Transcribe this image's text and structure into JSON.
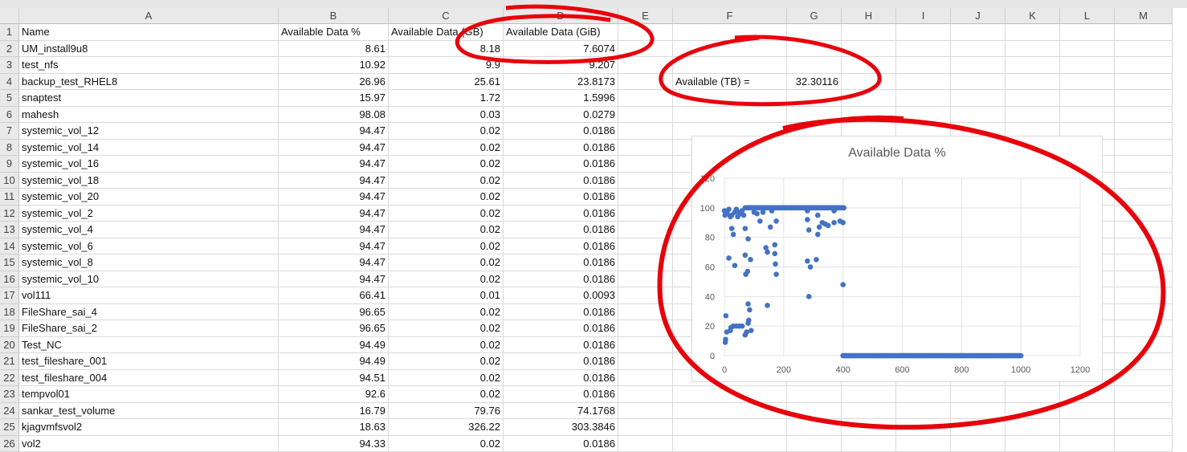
{
  "columns": [
    "A",
    "B",
    "C",
    "D",
    "E",
    "F",
    "G",
    "H",
    "I",
    "J",
    "K",
    "L",
    "M"
  ],
  "rows": [
    [
      "Name",
      "Available Data %",
      "Available Data (GB)",
      "Available Data (GiB)"
    ],
    [
      "UM_install9u8",
      "8.61",
      "8.18",
      "7.6074"
    ],
    [
      "test_nfs",
      "10.92",
      "9.9",
      "9.207"
    ],
    [
      "backup_test_RHEL8",
      "26.96",
      "25.61",
      "23.8173"
    ],
    [
      "snaptest",
      "15.97",
      "1.72",
      "1.5996"
    ],
    [
      "mahesh",
      "98.08",
      "0.03",
      "0.0279"
    ],
    [
      "systemic_vol_12",
      "94.47",
      "0.02",
      "0.0186"
    ],
    [
      "systemic_vol_14",
      "94.47",
      "0.02",
      "0.0186"
    ],
    [
      "systemic_vol_16",
      "94.47",
      "0.02",
      "0.0186"
    ],
    [
      "systemic_vol_18",
      "94.47",
      "0.02",
      "0.0186"
    ],
    [
      "systemic_vol_20",
      "94.47",
      "0.02",
      "0.0186"
    ],
    [
      "systemic_vol_2",
      "94.47",
      "0.02",
      "0.0186"
    ],
    [
      "systemic_vol_4",
      "94.47",
      "0.02",
      "0.0186"
    ],
    [
      "systemic_vol_6",
      "94.47",
      "0.02",
      "0.0186"
    ],
    [
      "systemic_vol_8",
      "94.47",
      "0.02",
      "0.0186"
    ],
    [
      "systemic_vol_10",
      "94.47",
      "0.02",
      "0.0186"
    ],
    [
      "vol111",
      "66.41",
      "0.01",
      "0.0093"
    ],
    [
      "FileShare_sai_4",
      "96.65",
      "0.02",
      "0.0186"
    ],
    [
      "FileShare_sai_2",
      "96.65",
      "0.02",
      "0.0186"
    ],
    [
      "Test_NC",
      "94.49",
      "0.02",
      "0.0186"
    ],
    [
      "test_fileshare_001",
      "94.49",
      "0.02",
      "0.0186"
    ],
    [
      "test_fileshare_004",
      "94.51",
      "0.02",
      "0.0186"
    ],
    [
      "tempvol01",
      "92.6",
      "0.02",
      "0.0186"
    ],
    [
      "sankar_test_volume",
      "16.79",
      "79.76",
      "74.1768"
    ],
    [
      "kjagvmfsvol2",
      "18.63",
      "326.22",
      "303.3846"
    ],
    [
      "vol2",
      "94.33",
      "0.02",
      "0.0186"
    ]
  ],
  "summary": {
    "label": "Available (TB) =",
    "value": "32.30116"
  },
  "chart_data": {
    "type": "scatter",
    "title": "Available Data %",
    "xlim": [
      0,
      1200
    ],
    "ylim": [
      0,
      120
    ],
    "xticks": [
      "0",
      "200",
      "400",
      "600",
      "800",
      "1000",
      "1200"
    ],
    "yticks": [
      "0",
      "20",
      "40",
      "60",
      "80",
      "100",
      "120"
    ],
    "grid": true,
    "color": "#4472c4",
    "points": [
      [
        0,
        98
      ],
      [
        2,
        95
      ],
      [
        5,
        27
      ],
      [
        3,
        9
      ],
      [
        4,
        11
      ],
      [
        8,
        16
      ],
      [
        20,
        17
      ],
      [
        22,
        19
      ],
      [
        30,
        20
      ],
      [
        40,
        20
      ],
      [
        50,
        20
      ],
      [
        60,
        20
      ],
      [
        10,
        96
      ],
      [
        20,
        94
      ],
      [
        25,
        86
      ],
      [
        30,
        82
      ],
      [
        35,
        61
      ],
      [
        15,
        66
      ],
      [
        70,
        14
      ],
      [
        75,
        16
      ],
      [
        80,
        22
      ],
      [
        82,
        24
      ],
      [
        80,
        35
      ],
      [
        85,
        31
      ],
      [
        90,
        17
      ],
      [
        72,
        55
      ],
      [
        78,
        57
      ],
      [
        70,
        68
      ],
      [
        88,
        65
      ],
      [
        70,
        86
      ],
      [
        80,
        79
      ],
      [
        120,
        91
      ],
      [
        140,
        73
      ],
      [
        145,
        70
      ],
      [
        145,
        34
      ],
      [
        155,
        87
      ],
      [
        170,
        75
      ],
      [
        170,
        69
      ],
      [
        172,
        62
      ],
      [
        175,
        55
      ],
      [
        175,
        91
      ],
      [
        280,
        92
      ],
      [
        285,
        85
      ],
      [
        280,
        64
      ],
      [
        290,
        60
      ],
      [
        285,
        40
      ],
      [
        310,
        65
      ],
      [
        315,
        95
      ],
      [
        315,
        82
      ],
      [
        320,
        87
      ],
      [
        330,
        90
      ],
      [
        340,
        89
      ],
      [
        350,
        88
      ],
      [
        370,
        90
      ],
      [
        390,
        91
      ],
      [
        400,
        90
      ],
      [
        400,
        48
      ],
      [
        100,
        97
      ],
      [
        110,
        96
      ],
      [
        130,
        97
      ],
      [
        160,
        98
      ],
      [
        280,
        98
      ],
      [
        370,
        98
      ],
      [
        5,
        97
      ],
      [
        15,
        99
      ],
      [
        25,
        95
      ],
      [
        35,
        97
      ],
      [
        45,
        94
      ],
      [
        55,
        96
      ],
      [
        60,
        98
      ],
      [
        65,
        95
      ],
      [
        40,
        99
      ],
      [
        50,
        97
      ]
    ],
    "dense_runs": [
      {
        "from": 70,
        "to": 405,
        "y": 100
      },
      {
        "from": 400,
        "to": 1000,
        "y": 0
      }
    ]
  },
  "annotation_color": "#e8000b"
}
